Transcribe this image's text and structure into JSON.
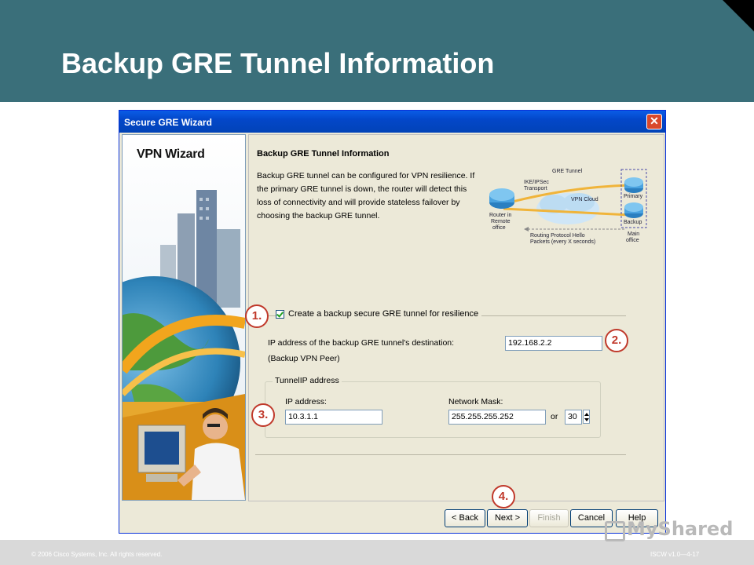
{
  "slide": {
    "title": "Backup GRE Tunnel Information",
    "footer_left": "© 2006 Cisco Systems, Inc. All rights reserved.",
    "footer_right": "ISCW v1.0—4-17",
    "watermark": "MyShared",
    "header_color": "#3a6f7a"
  },
  "dialog": {
    "title": "Secure GRE Wizard",
    "close_label": "✕",
    "side_title": "VPN Wizard",
    "section_heading": "Backup GRE Tunnel Information",
    "description": "Backup GRE tunnel can be configured for VPN resilience. If the primary GRE tunnel is down, the router will detect this loss of connectivity and will provide stateless failover by choosing the backup GRE tunnel.",
    "diagram": {
      "gre_tunnel": "GRE Tunnel",
      "ike_ipsec": "IKE/IPSec",
      "transport": "Transport",
      "vpn_cloud": "VPN Cloud",
      "primary": "Primary",
      "backup": "Backup",
      "router_in": "Router in",
      "remote": "Remote",
      "office": "office",
      "main": "Main",
      "main_office": "office",
      "routing_line1": "Routing Protocol Hello",
      "routing_line2": "Packets (every X seconds)"
    },
    "checkbox_label": "Create a backup secure GRE tunnel for resilience",
    "checkbox_checked": true,
    "dest_label_line1": "IP address of the backup GRE tunnel's destination:",
    "dest_label_line2": "(Backup VPN Peer)",
    "dest_value": "192.168.2.2",
    "tunnel_group_label": "TunnelIP address",
    "ip_label": "IP address:",
    "ip_value": "10.3.1.1",
    "mask_label": "Network Mask:",
    "mask_value": "255.255.255.252",
    "or_label": "or",
    "bits_value": "30",
    "buttons": {
      "back": "< Back",
      "next": "Next >",
      "finish": "Finish",
      "cancel": "Cancel",
      "help": "Help"
    }
  },
  "callouts": [
    "1.",
    "2.",
    "3.",
    "4."
  ],
  "colors": {
    "callout": "#c0392b",
    "titlebar": "#0a5ce6"
  }
}
